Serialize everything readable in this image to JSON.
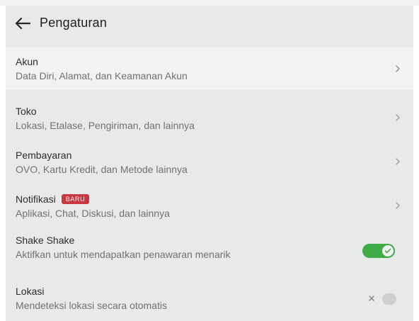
{
  "header": {
    "title": "Pengaturan",
    "back_icon": "back-arrow-icon"
  },
  "items": [
    {
      "title": "Akun",
      "subtitle": "Data Diri, Alamat, dan Keamanan Akun",
      "type": "nav",
      "icon": "chevron-right-icon"
    },
    {
      "title": "Toko",
      "subtitle": "Lokasi, Etalase, Pengiriman, dan lainnya",
      "type": "nav",
      "icon": "chevron-right-icon"
    },
    {
      "title": "Pembayaran",
      "subtitle": "OVO, Kartu Kredit, dan Metode lainnya",
      "type": "nav",
      "icon": "chevron-right-icon"
    },
    {
      "title": "Notifikasi",
      "badge": "BARU",
      "subtitle": "Aplikasi, Chat, Diskusi, dan lainnya",
      "type": "nav",
      "icon": "chevron-right-icon"
    },
    {
      "title": "Shake Shake",
      "subtitle": "Aktifkan untuk mendapatkan penawaran menarik",
      "type": "toggle",
      "toggle_on": true,
      "icon": "check-icon"
    },
    {
      "title": "Lokasi",
      "subtitle": "Mendeteksi lokasi secara otomatis",
      "type": "toggle",
      "toggle_on": false,
      "icon": "close-icon"
    }
  ],
  "colors": {
    "screen_bg": "#f6f6f6",
    "selected_row_bg": "#ffffff",
    "toggle_on": "#42b549",
    "badge_bg": "#d23b46",
    "text_primary": "#2f2f2f",
    "text_secondary": "#787878"
  }
}
